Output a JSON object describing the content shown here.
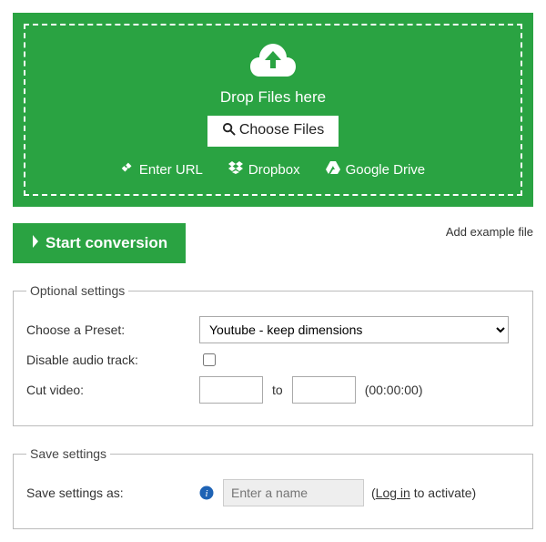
{
  "dropzone": {
    "drop_text": "Drop Files here",
    "choose_label": "Choose Files",
    "links": {
      "url": "Enter URL",
      "dropbox": "Dropbox",
      "gdrive": "Google Drive"
    }
  },
  "actions": {
    "start_label": "Start conversion",
    "add_example_label": "Add example file"
  },
  "optional": {
    "legend": "Optional settings",
    "preset_label": "Choose a Preset:",
    "preset_value": "Youtube - keep dimensions",
    "disable_audio_label": "Disable audio track:",
    "cut_label": "Cut video:",
    "to_label": "to",
    "cut_hint": "(00:00:00)"
  },
  "save": {
    "legend": "Save settings",
    "label": "Save settings as:",
    "placeholder": "Enter a name",
    "login_text": "Log in",
    "activate_suffix": " to activate)"
  }
}
